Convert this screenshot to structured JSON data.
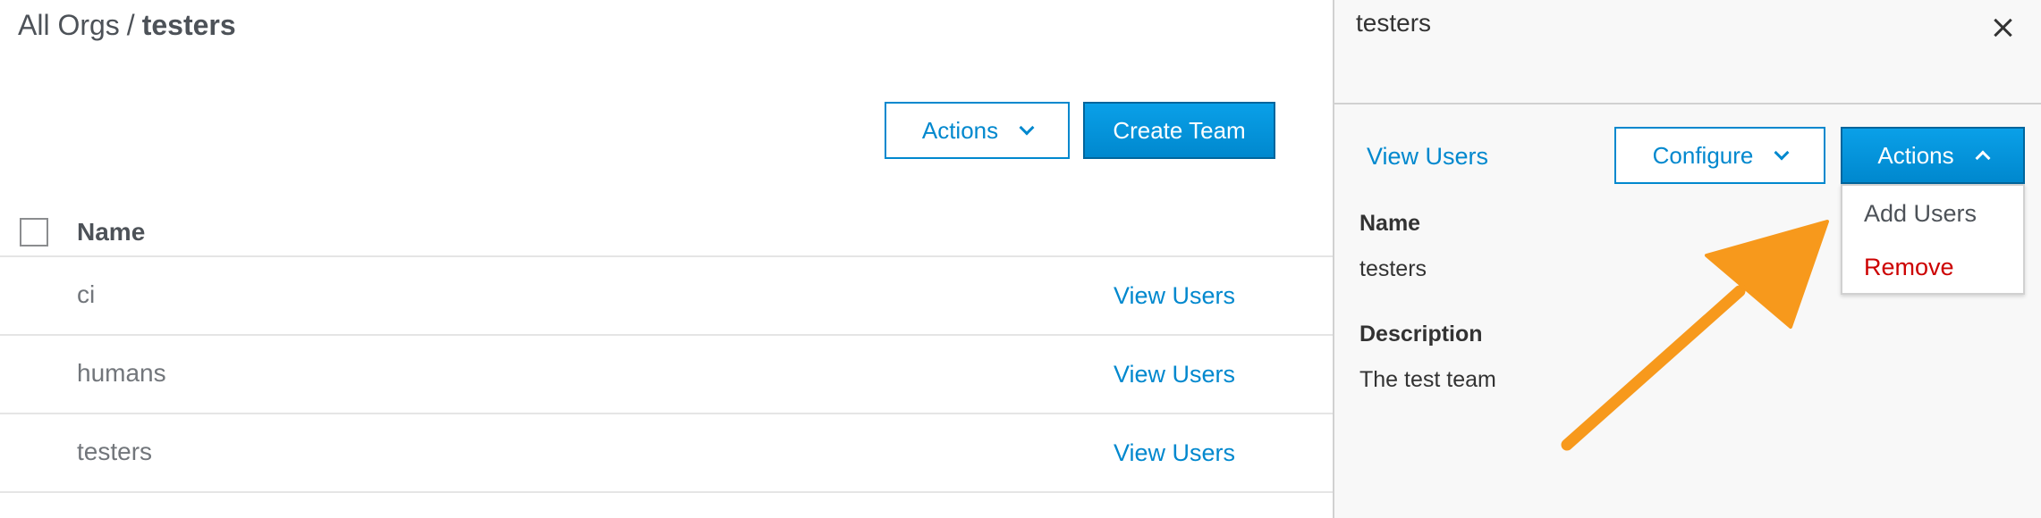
{
  "breadcrumb": {
    "root": "All Orgs",
    "separator": "/",
    "current": "testers"
  },
  "toolbar": {
    "actions_label": "Actions",
    "create_team_label": "Create Team"
  },
  "table": {
    "header_name": "Name",
    "rows": [
      {
        "name": "ci",
        "link": "View Users"
      },
      {
        "name": "humans",
        "link": "View Users"
      },
      {
        "name": "testers",
        "link": "View Users"
      }
    ]
  },
  "panel": {
    "title": "testers",
    "view_users_label": "View Users",
    "configure_label": "Configure",
    "actions_label": "Actions",
    "menu": {
      "add_users": "Add Users",
      "remove": "Remove"
    },
    "details": {
      "name_label": "Name",
      "name_value": "testers",
      "description_label": "Description",
      "description_value": "The test team"
    }
  },
  "colors": {
    "accent": "#0088ce",
    "danger": "#cc0000",
    "annotation_arrow": "#f7991c"
  },
  "icons": {
    "dropdown": "chevron-down-icon",
    "dropdown_open": "chevron-up-icon",
    "close": "close-icon",
    "annotation": "arrow-annotation-icon"
  }
}
